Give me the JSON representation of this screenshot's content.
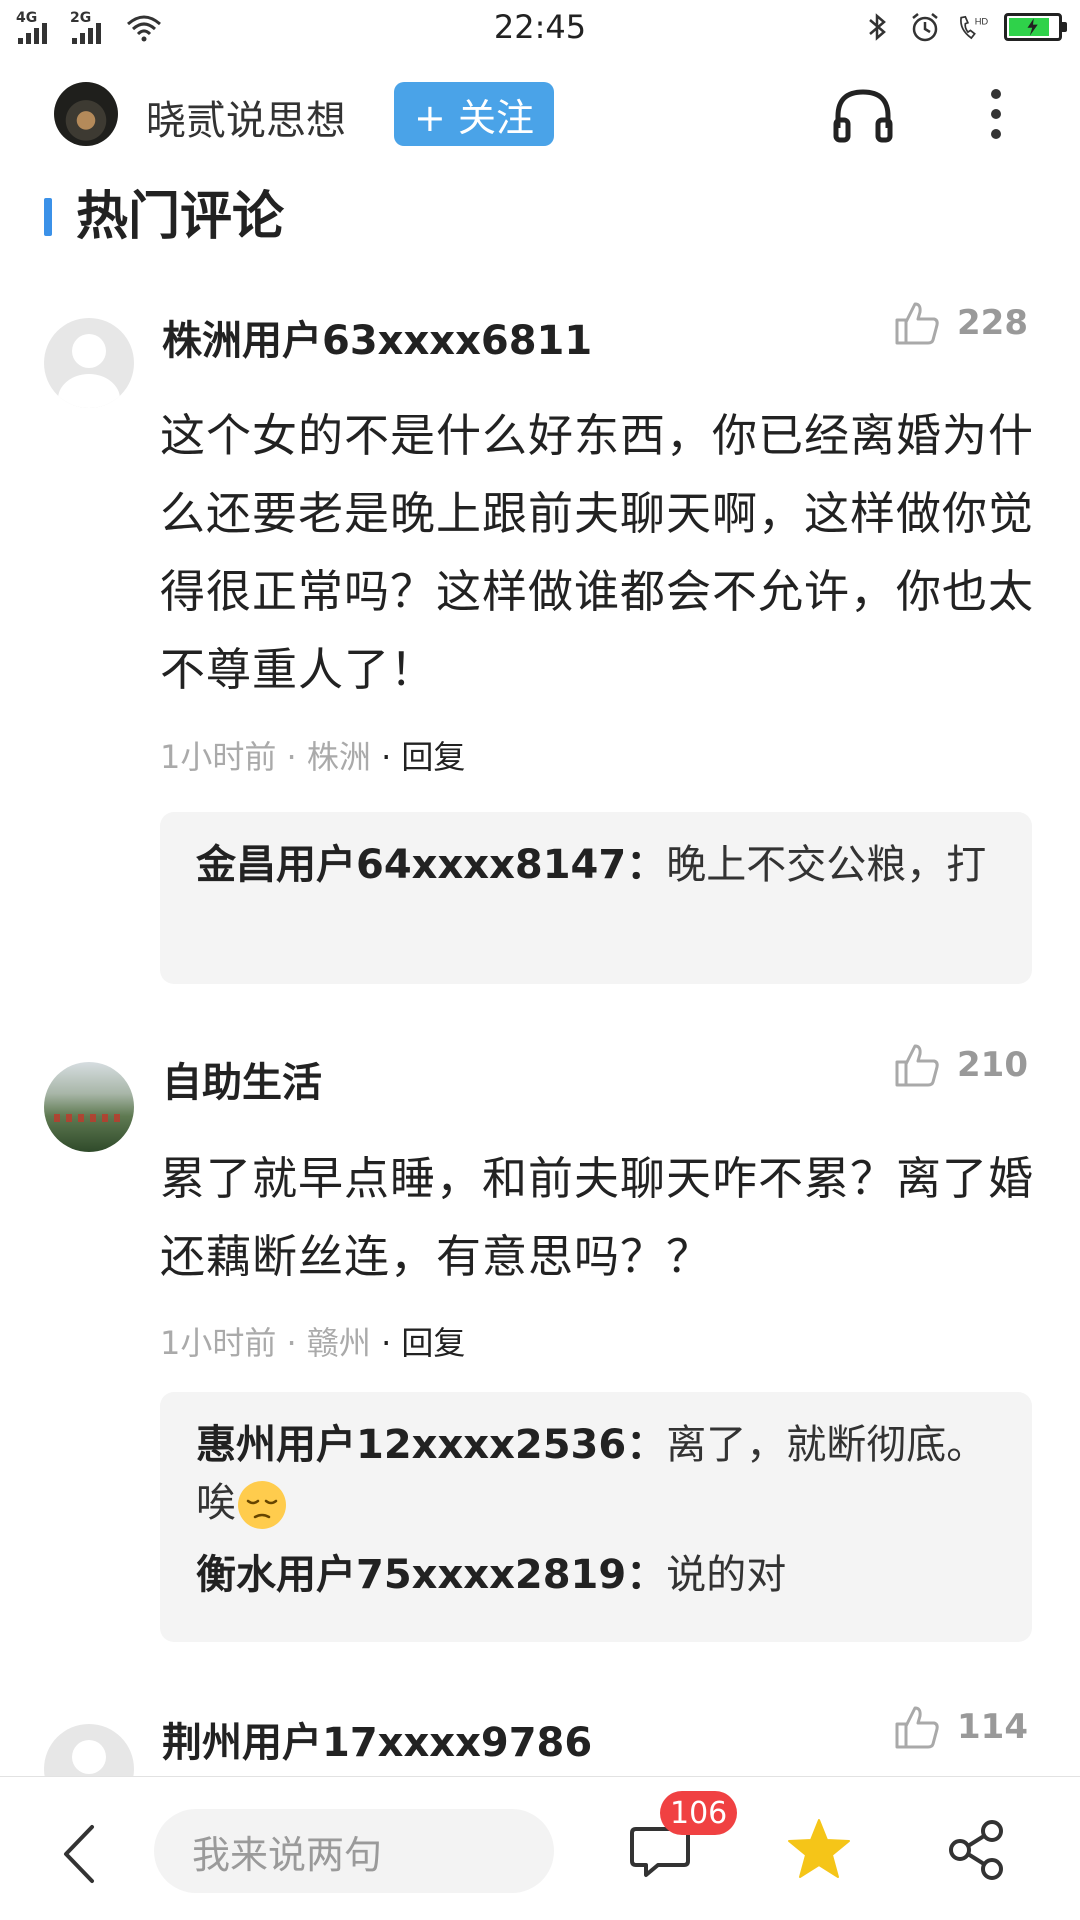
{
  "status_bar": {
    "time": "22:45",
    "net1": "4G",
    "net2": "2G",
    "hd_label": "HD"
  },
  "header": {
    "author_name": "晓贰说思想",
    "follow_label": "+ 关注"
  },
  "section": {
    "title": "热门评论"
  },
  "comments": [
    {
      "user": "株洲用户63xxxx6811",
      "likes": "228",
      "text": "这个女的不是什么好东西，你已经离婚为什么还要老是晚上跟前夫聊天啊，这样做你觉得很正常吗？这样做谁都会不允许，你也太不尊重人了！",
      "time": "1小时前",
      "location": "株洲",
      "reply_label": "回复",
      "replies": [
        {
          "user": "金昌用户64xxxx8147：",
          "text": "晚上不交公粮，打"
        }
      ]
    },
    {
      "user": "自助生活",
      "likes": "210",
      "text": "累了就早点睡，和前夫聊天咋不累？离了婚还藕断丝连，有意思吗？？",
      "time": "1小时前",
      "location": "赣州",
      "reply_label": "回复",
      "replies": [
        {
          "user": "惠州用户12xxxx2536：",
          "text": "离了，就断彻底。唉"
        },
        {
          "user": "衡水用户75xxxx2819：",
          "text": "说的对"
        }
      ]
    },
    {
      "user": "荆州用户17xxxx9786",
      "likes": "114"
    }
  ],
  "bottom_bar": {
    "input_placeholder": "我来说两句",
    "comment_count": "106"
  },
  "colors": {
    "follow_button": "#4aa3e8",
    "section_bar": "#3b91e8",
    "badge": "#f04142",
    "star": "#f5c518",
    "battery_fill": "#2fd24a"
  },
  "battery_level": 0.85
}
